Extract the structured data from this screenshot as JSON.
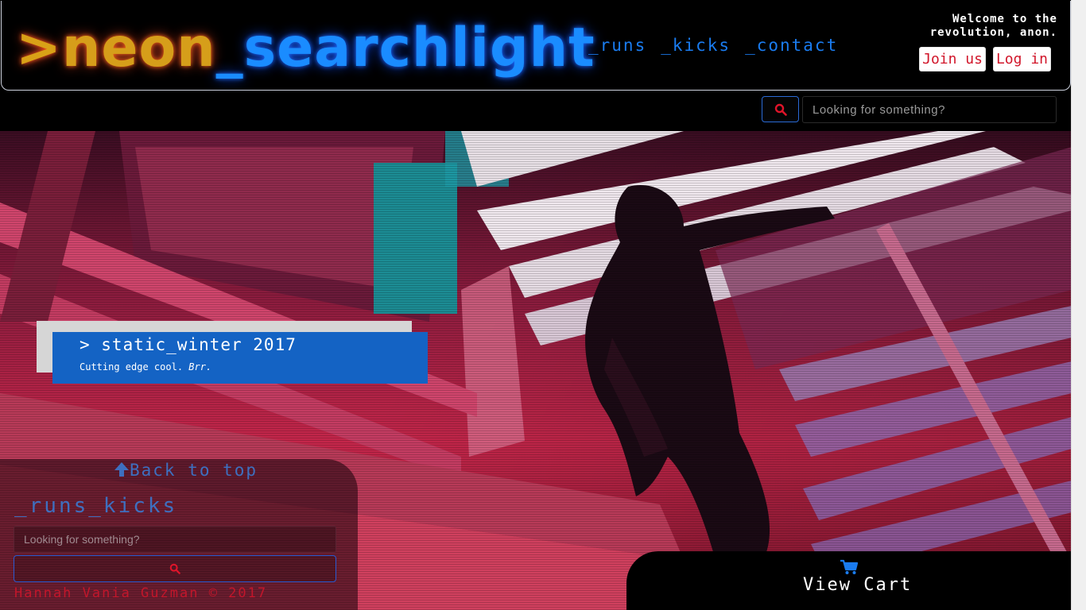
{
  "header": {
    "logo": {
      "prompt": ">",
      "word1": "neon",
      "word2": "_searchlight"
    },
    "nav": [
      {
        "label": "_runs"
      },
      {
        "label": "_kicks"
      },
      {
        "label": "_contact"
      }
    ],
    "welcome_line1": "Welcome to the",
    "welcome_line2": "revolution, anon.",
    "join_label": "Join us",
    "login_label": "Log in"
  },
  "search": {
    "placeholder": "Looking for something?"
  },
  "hero": {
    "caption_title": "> static_winter 2017",
    "caption_sub": "Cutting edge cool.",
    "caption_sub_em": "Brr."
  },
  "footer": {
    "back_to_top": "Back to top",
    "title": "_runs_kicks",
    "search_placeholder": "Looking for something?",
    "copyright": "Hannah Vania Guzman © 2017"
  },
  "cart": {
    "label": "View Cart"
  },
  "colors": {
    "accent_blue": "#1a7cf0",
    "accent_orange": "#d69e1a",
    "accent_red": "#c2162b",
    "caption_blue": "#1463c4"
  }
}
